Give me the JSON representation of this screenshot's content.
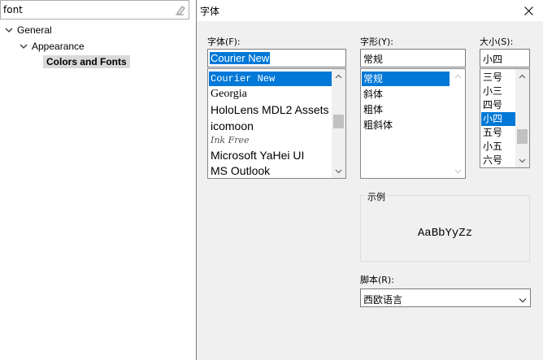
{
  "preferences": {
    "filter_text": "font",
    "tree": [
      {
        "label": "General",
        "expanded": true
      },
      {
        "label": "Appearance",
        "expanded": true
      },
      {
        "label": "Colors and Fonts",
        "selected": true
      }
    ]
  },
  "dialog": {
    "title": "字体",
    "font": {
      "label": "字体(F):",
      "value": "Courier New",
      "items": [
        {
          "label": "Courier New",
          "selected": true
        },
        {
          "label": "Georgia"
        },
        {
          "label": "HoloLens MDL2 Assets"
        },
        {
          "label": "icomoon"
        },
        {
          "label": "Ink Free"
        },
        {
          "label": "Microsoft YaHei UI"
        },
        {
          "label": "MS Outlook"
        }
      ]
    },
    "style": {
      "label": "字形(Y):",
      "value": "常规",
      "items": [
        {
          "label": "常规",
          "selected": true
        },
        {
          "label": "斜体"
        },
        {
          "label": "粗体"
        },
        {
          "label": "粗斜体"
        }
      ]
    },
    "size": {
      "label": "大小(S):",
      "value": "小四",
      "items": [
        {
          "label": "三号"
        },
        {
          "label": "小三"
        },
        {
          "label": "四号"
        },
        {
          "label": "小四",
          "selected": true
        },
        {
          "label": "五号"
        },
        {
          "label": "小五"
        },
        {
          "label": "六号"
        }
      ]
    },
    "sample": {
      "label": "示例",
      "text": "AaBbYyZz"
    },
    "script": {
      "label": "脚本(R):",
      "value": "西欧语言"
    }
  },
  "colors": {
    "selection": "#0078d7",
    "dialog_bg": "#f0f0f0",
    "tree_selected_bg": "#d9d9d9"
  }
}
